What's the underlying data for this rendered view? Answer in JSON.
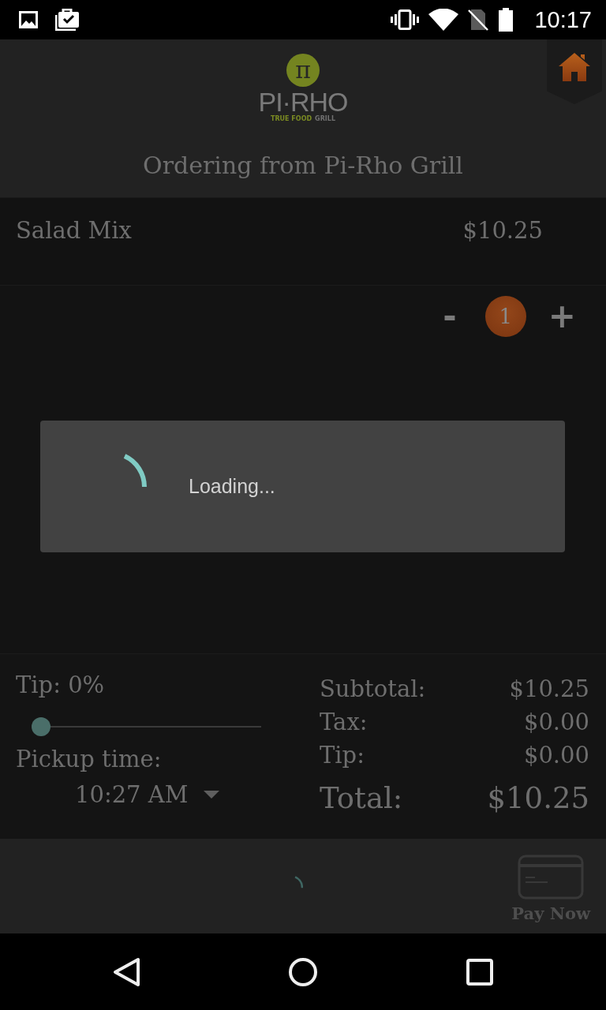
{
  "status_bar": {
    "time": "10:17"
  },
  "header": {
    "logo": {
      "mark": "π",
      "name": "PI·RHO",
      "tagline_accent": "TRUE FOOD",
      "tagline_rest": "GRILL"
    },
    "title": "Ordering from Pi-Rho Grill"
  },
  "order_items": [
    {
      "name": "Salad Mix",
      "price": "$10.25",
      "decrement": "-",
      "quantity": "1",
      "increment": "+"
    }
  ],
  "loading_dialog": {
    "message": "Loading..."
  },
  "tip": {
    "label": "Tip: 0%",
    "level": 0
  },
  "pickup": {
    "label": "Pickup time:",
    "time": "10:27 AM"
  },
  "totals": [
    {
      "kind": "line",
      "label": "Subtotal:",
      "value": "$10.25"
    },
    {
      "kind": "line",
      "label": "Tax:",
      "value": "$0.00"
    },
    {
      "kind": "line",
      "label": "Tip:",
      "value": "$0.00"
    },
    {
      "kind": "total",
      "label": "Total:",
      "value": "$10.25"
    }
  ],
  "pay_button": {
    "label": "Pay Now",
    "disabled": true
  }
}
